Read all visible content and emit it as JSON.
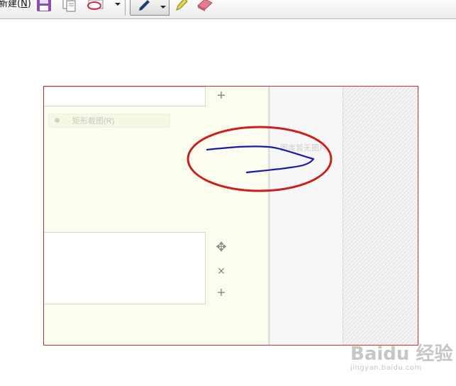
{
  "toolbar": {
    "new_label": "新建",
    "new_shortcut": "N",
    "icons": [
      "save-icon",
      "copy-icon",
      "send-email-icon",
      "dropdown-icon",
      "pen-icon",
      "highlighter-icon",
      "eraser-icon"
    ]
  },
  "capture": {
    "mode_label": "矩形截图(R)"
  },
  "gallery": {
    "empty_text": "图库暂无图片"
  },
  "controls": {
    "add_top": "+",
    "move": "✥",
    "remove": "×",
    "add_bottom": "+"
  },
  "watermark": {
    "brand": "Baidu 经验",
    "url": "jingyan.baidu.com"
  },
  "colors": {
    "panel_border": "#d22b2b",
    "annotation_circle": "#cc1f1f",
    "annotation_stroke": "#1a1aa8",
    "toolbar_bg": "#ececec"
  }
}
